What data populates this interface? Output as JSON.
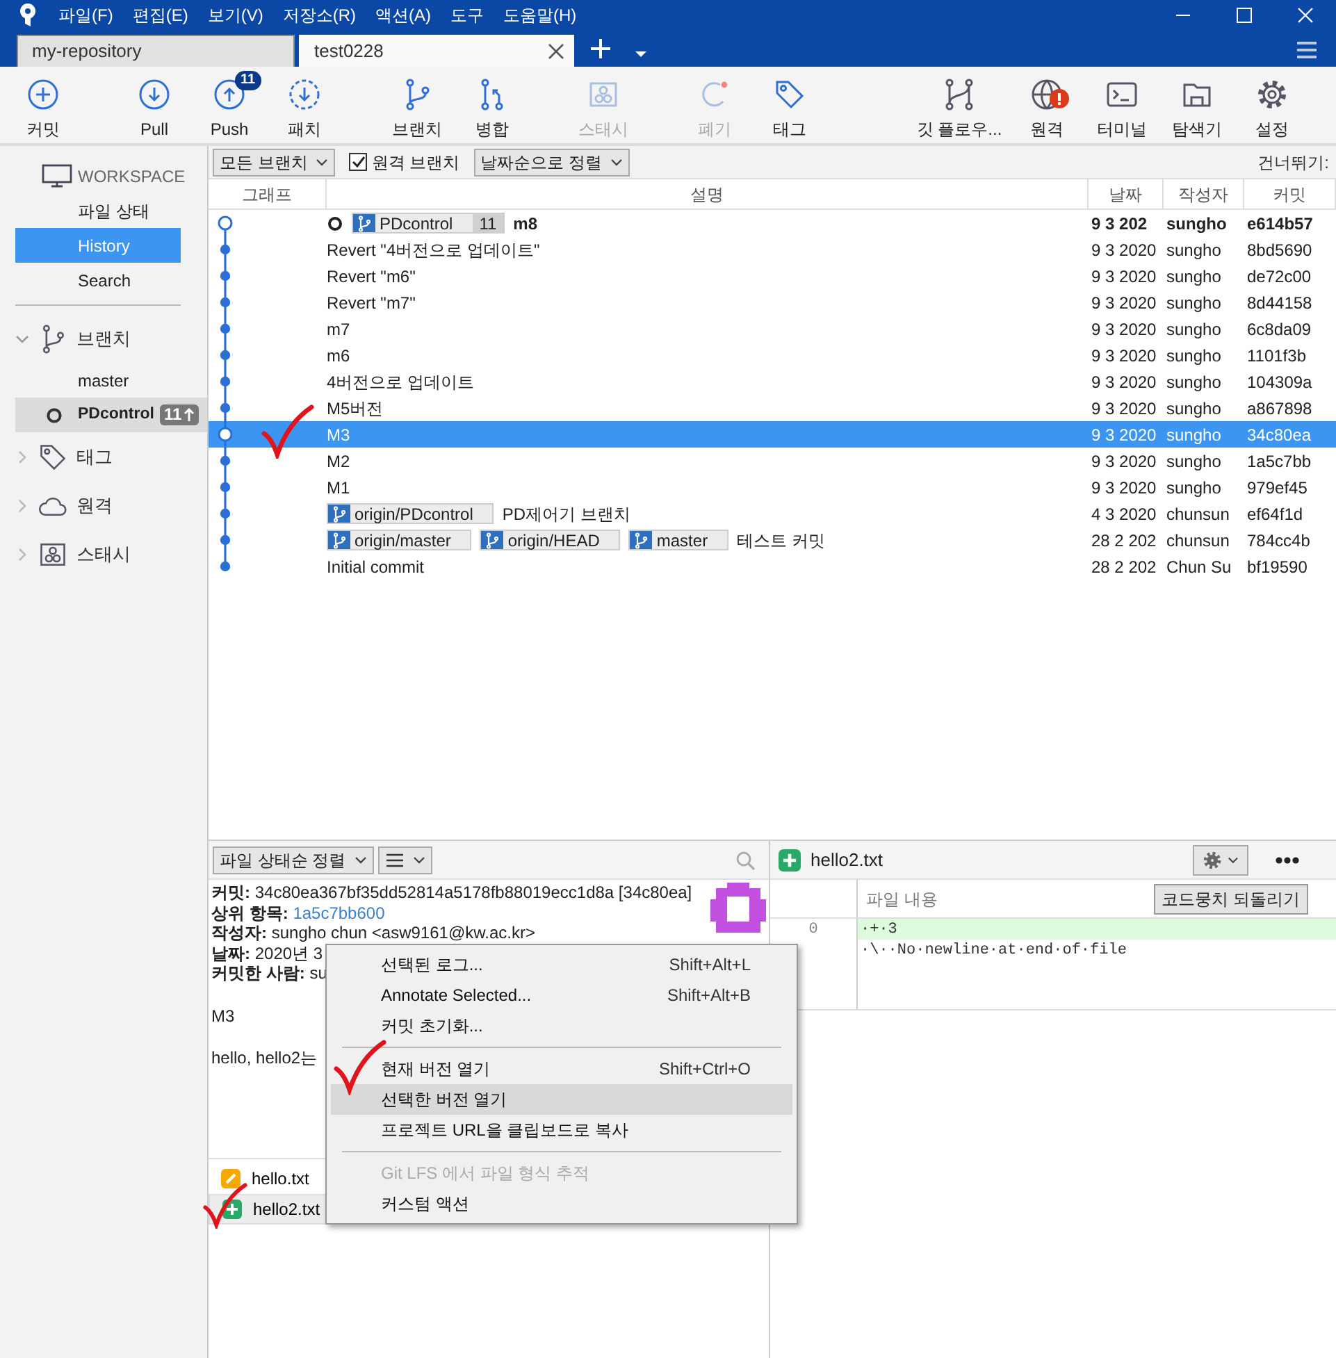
{
  "menu_bar": [
    "파일(F)",
    "편집(E)",
    "보기(V)",
    "저장소(R)",
    "액션(A)",
    "도구",
    "도움말(H)"
  ],
  "repo_tabs": [
    {
      "label": "my-repository",
      "selected": false
    },
    {
      "label": "test0228",
      "selected": true
    }
  ],
  "toolbar": [
    {
      "kind": "commit",
      "label": "커밋",
      "disabled": false
    },
    {
      "kind": "pull",
      "label": "Pull",
      "disabled": false
    },
    {
      "kind": "push",
      "label": "Push",
      "disabled": false,
      "badge": "11"
    },
    {
      "kind": "fetch",
      "label": "패치",
      "disabled": false
    },
    {
      "kind": "branch",
      "label": "브랜치",
      "disabled": false
    },
    {
      "kind": "merge",
      "label": "병합",
      "disabled": false
    },
    {
      "kind": "stash",
      "label": "스태시",
      "disabled": true
    },
    {
      "kind": "discard",
      "label": "폐기",
      "disabled": true
    },
    {
      "kind": "tag",
      "label": "태그",
      "disabled": false
    },
    {
      "kind": "gitflow",
      "label": "깃 플로우...",
      "disabled": false
    },
    {
      "kind": "remote",
      "label": "원격",
      "disabled": false,
      "alert": true
    },
    {
      "kind": "terminal",
      "label": "터미널",
      "disabled": false
    },
    {
      "kind": "explorer",
      "label": "탐색기",
      "disabled": false
    },
    {
      "kind": "settings",
      "label": "설정",
      "disabled": false
    }
  ],
  "sidebar": {
    "workspace": {
      "title": "WORKSPACE",
      "items": [
        {
          "label": "파일 상태",
          "selected": false
        },
        {
          "label": "History",
          "selected": true
        },
        {
          "label": "Search",
          "selected": false
        }
      ]
    },
    "sections": [
      {
        "kind": "branch",
        "label": "브랜치",
        "expanded": true,
        "children": [
          {
            "label": "master",
            "current": false,
            "selected": false
          },
          {
            "label": "PDcontrol",
            "current": true,
            "selected": true,
            "ahead": "11"
          }
        ]
      },
      {
        "kind": "tag",
        "label": "태그",
        "expanded": false
      },
      {
        "kind": "remote",
        "label": "원격",
        "expanded": false
      },
      {
        "kind": "stash",
        "label": "스태시",
        "expanded": false
      }
    ]
  },
  "filter_bar": {
    "branch_filter": "모든 브랜치",
    "remote_branches": {
      "label": "원격 브랜치",
      "checked": true
    },
    "sort": "날짜순으로 정렬",
    "jump_label": "건너뛰기:"
  },
  "table": {
    "columns": [
      "그래프",
      "설명",
      "날짜",
      "작성자",
      "커밋"
    ],
    "rows": [
      {
        "refs": [
          {
            "label": "PDcontrol",
            "count": "11"
          }
        ],
        "message": "m8",
        "date": "9 3 202",
        "author": "sungho",
        "commit": "e614b57",
        "head": true,
        "bold": true,
        "selected": false
      },
      {
        "refs": [],
        "message": "Revert \"4버전으로 업데이트\"",
        "date": "9 3 2020",
        "author": "sungho",
        "commit": "8bd5690",
        "head": false,
        "bold": false,
        "selected": false
      },
      {
        "refs": [],
        "message": "Revert \"m6\"",
        "date": "9 3 2020",
        "author": "sungho",
        "commit": "de72c00",
        "head": false,
        "bold": false,
        "selected": false
      },
      {
        "refs": [],
        "message": "Revert \"m7\"",
        "date": "9 3 2020",
        "author": "sungho",
        "commit": "8d44158",
        "head": false,
        "bold": false,
        "selected": false
      },
      {
        "refs": [],
        "message": "m7",
        "date": "9 3 2020",
        "author": "sungho",
        "commit": "6c8da09",
        "head": false,
        "bold": false,
        "selected": false
      },
      {
        "refs": [],
        "message": "m6",
        "date": "9 3 2020",
        "author": "sungho",
        "commit": "1101f3b",
        "head": false,
        "bold": false,
        "selected": false
      },
      {
        "refs": [],
        "message": "4버전으로 업데이트",
        "date": "9 3 2020",
        "author": "sungho",
        "commit": "104309a",
        "head": false,
        "bold": false,
        "selected": false
      },
      {
        "refs": [],
        "message": "M5버전",
        "date": "9 3 2020",
        "author": "sungho",
        "commit": "a867898",
        "head": false,
        "bold": false,
        "selected": false
      },
      {
        "refs": [],
        "message": "M3",
        "date": "9 3 2020",
        "author": "sungho",
        "commit": "34c80ea",
        "head": false,
        "bold": false,
        "selected": true
      },
      {
        "refs": [],
        "message": "M2",
        "date": "9 3 2020",
        "author": "sungho",
        "commit": "1a5c7bb",
        "head": false,
        "bold": false,
        "selected": false
      },
      {
        "refs": [],
        "message": "M1",
        "date": "9 3 2020",
        "author": "sungho",
        "commit": "979ef45",
        "head": false,
        "bold": false,
        "selected": false
      },
      {
        "refs": [
          {
            "label": "origin/PDcontrol"
          }
        ],
        "message": "PD제어기 브랜치",
        "date": "4 3 2020",
        "author": "chunsun",
        "commit": "ef64f1d",
        "head": false,
        "bold": false,
        "selected": false
      },
      {
        "refs": [
          {
            "label": "origin/master"
          },
          {
            "label": "origin/HEAD"
          },
          {
            "label": "master"
          }
        ],
        "message": "테스트 커밋",
        "date": "28 2 202",
        "author": "chunsun",
        "commit": "784cc4b",
        "head": false,
        "bold": false,
        "selected": false
      },
      {
        "refs": [],
        "message": "Initial commit",
        "date": "28 2 202",
        "author": "Chun Su",
        "commit": "bf19590",
        "head": false,
        "bold": false,
        "selected": false
      }
    ]
  },
  "details": {
    "sort": "파일 상태순 정렬",
    "lines": [
      {
        "label": "커밋:",
        "value": "34c80ea367bf35dd52814a5178fb88019ecc1d8a [34c80ea]",
        "link": false
      },
      {
        "label": "상위 항목:",
        "value": "1a5c7bb600",
        "link": true
      },
      {
        "label": "작성자:",
        "value": "sungho chun <asw9161@kw.ac.kr>",
        "link": false
      },
      {
        "label": "날짜:",
        "value": "2020년 3",
        "link": false
      },
      {
        "label": "커밋한 사람:",
        "value": "su",
        "link": false
      }
    ],
    "message": [
      "M3",
      "hello, hello2는"
    ],
    "files": [
      {
        "name": "hello.txt",
        "kind": "modified",
        "selected": false
      },
      {
        "name": "hello2.txt",
        "kind": "added",
        "selected": true
      }
    ]
  },
  "diff": {
    "file": "hello2.txt",
    "kind": "added",
    "content_label": "파일 내용",
    "revert_button": "코드뭉치 되돌리기",
    "lines": [
      {
        "kind": "added",
        "number": "0",
        "text": "·+·3"
      },
      {
        "kind": "meta",
        "text": "·\\··No·newline·at·end·of·file"
      }
    ]
  },
  "context_menu": [
    {
      "kind": "item",
      "label": "선택된 로그...",
      "shortcut": "Shift+Alt+L",
      "disabled": false,
      "selected": false
    },
    {
      "kind": "item",
      "label": "Annotate Selected...",
      "shortcut": "Shift+Alt+B",
      "disabled": false,
      "selected": false
    },
    {
      "kind": "item",
      "label": "커밋 초기화...",
      "disabled": false,
      "selected": false
    },
    {
      "kind": "separator"
    },
    {
      "kind": "item",
      "label": "현재 버전 열기",
      "shortcut": "Shift+Ctrl+O",
      "disabled": false,
      "selected": false
    },
    {
      "kind": "item",
      "label": "선택한 버전 열기",
      "disabled": false,
      "selected": true
    },
    {
      "kind": "item",
      "label": "프로젝트 URL을 클립보드로 복사",
      "disabled": false,
      "selected": false
    },
    {
      "kind": "separator"
    },
    {
      "kind": "item",
      "label": "Git LFS 에서 파일 형식 추적",
      "disabled": true,
      "selected": false
    },
    {
      "kind": "item",
      "label": "커스텀 액션",
      "disabled": false,
      "selected": false
    }
  ]
}
